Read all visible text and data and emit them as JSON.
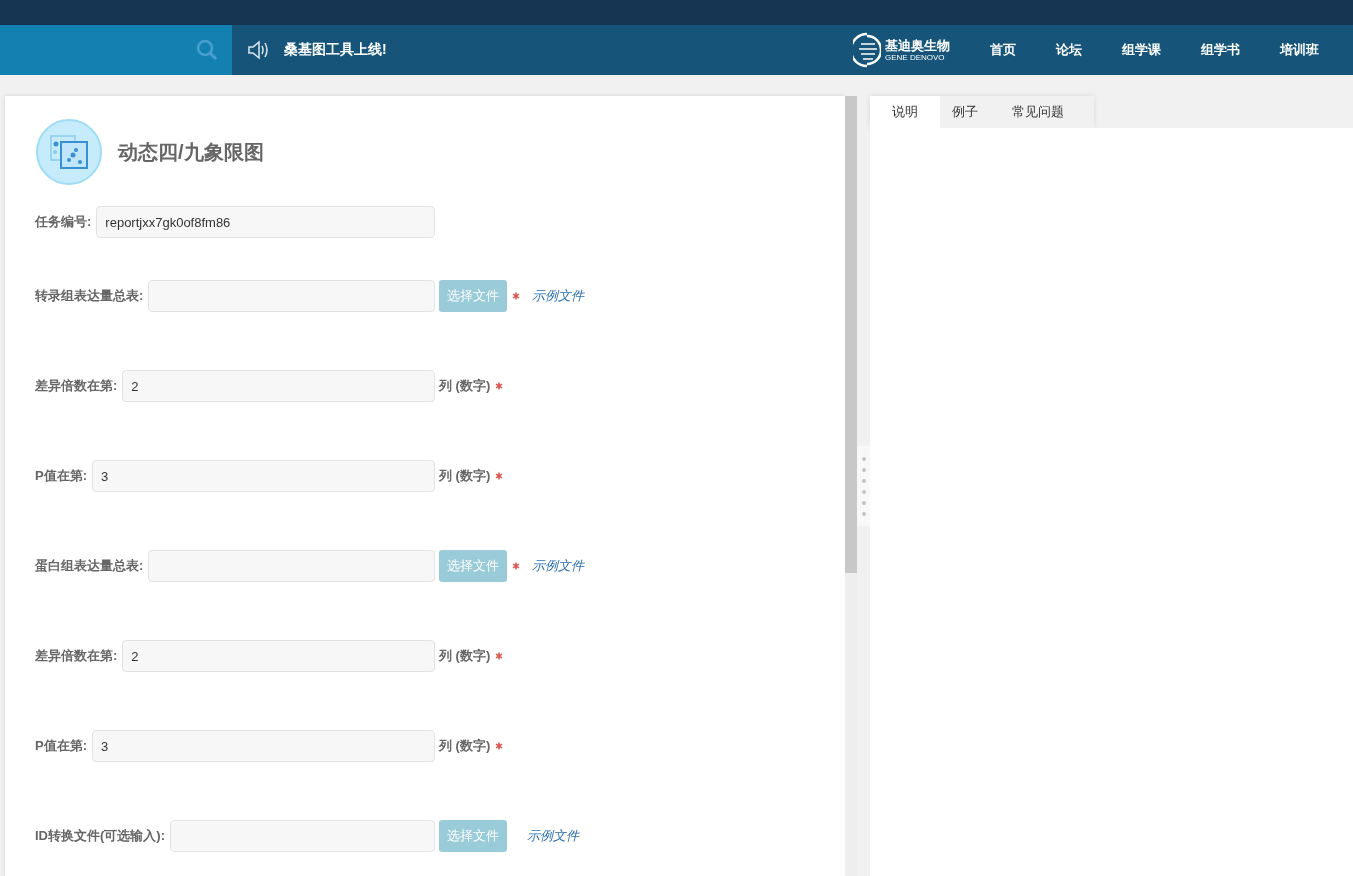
{
  "header": {
    "announcement": "桑基图工具上线!",
    "logo": {
      "name": "基迪奥生物",
      "subtitle": "GENE DENOVO"
    },
    "nav": [
      {
        "label": "首页"
      },
      {
        "label": "论坛"
      },
      {
        "label": "组学课"
      },
      {
        "label": "组学书"
      },
      {
        "label": "培训班"
      }
    ]
  },
  "tool": {
    "title": "动态四/九象限图",
    "task": {
      "label": "任务编号:",
      "value": "reportjxx7gk0of8fm86"
    },
    "fields": [
      {
        "kind": "file",
        "label": "转录组表达量总表:",
        "button": "选择文件",
        "required": true,
        "link": "示例文件"
      },
      {
        "kind": "number",
        "label": "差异倍数在第:",
        "value": "2",
        "suffix": "列 (数字)",
        "required": true
      },
      {
        "kind": "number",
        "label": "P值在第:",
        "value": "3",
        "suffix": "列 (数字)",
        "required": true
      },
      {
        "kind": "file",
        "label": "蛋白组表达量总表:",
        "button": "选择文件",
        "required": true,
        "link": "示例文件"
      },
      {
        "kind": "number",
        "label": "差异倍数在第:",
        "value": "2",
        "suffix": "列 (数字)",
        "required": true
      },
      {
        "kind": "number",
        "label": "P值在第:",
        "value": "3",
        "suffix": "列 (数字)",
        "required": true
      },
      {
        "kind": "file",
        "label": "ID转换文件(可选输入):",
        "button": "选择文件",
        "required": false,
        "link": "示例文件"
      }
    ]
  },
  "help_tabs": [
    {
      "label": "说明",
      "selected": true
    },
    {
      "label": "例子",
      "selected": false
    },
    {
      "label": "常见问题",
      "selected": false
    }
  ]
}
